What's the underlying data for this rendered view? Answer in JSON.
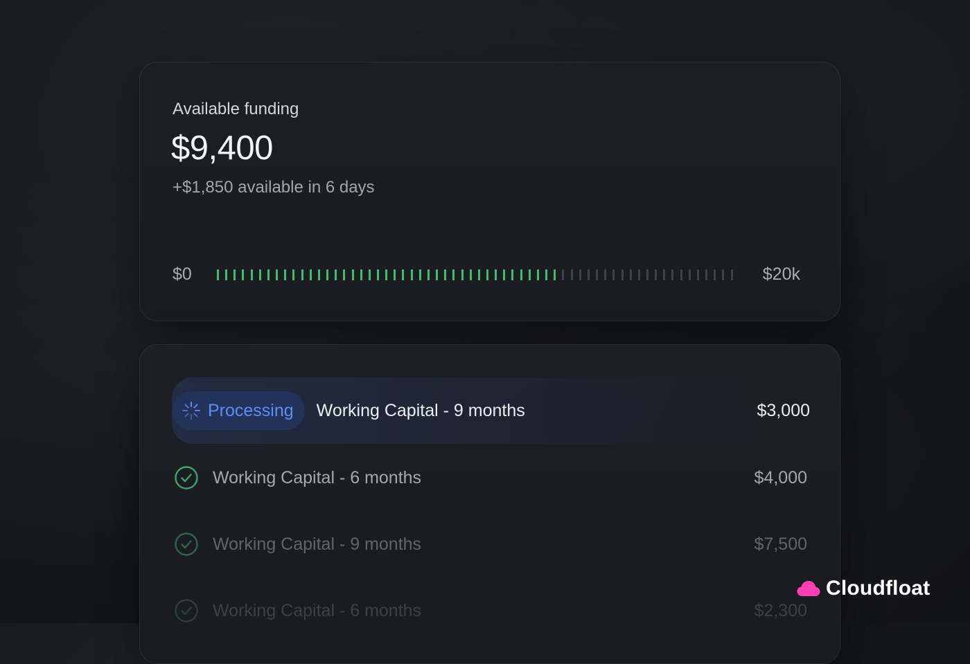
{
  "funding": {
    "label": "Available funding",
    "amount": "$9,400",
    "subtext": "+$1,850 available in 6 days",
    "range_min": "$0",
    "range_max": "$20k",
    "meter_fraction": 0.66,
    "meter_ticks": 62
  },
  "transactions": [
    {
      "status": "Processing",
      "title": "Working Capital - 9 months",
      "amount": "$3,000"
    },
    {
      "status": "complete",
      "title": "Working Capital - 6 months",
      "amount": "$4,000"
    },
    {
      "status": "complete",
      "title": "Working Capital - 9 months",
      "amount": "$7,500"
    },
    {
      "status": "complete",
      "title": "Working Capital - 6 months",
      "amount": "$2,300"
    }
  ],
  "brand": {
    "name": "Cloudfloat",
    "icon": "cloud-icon",
    "accent": "#ff3fb4"
  },
  "colors": {
    "meter_on": "#3fbf6c",
    "meter_off": "#3e4148",
    "processing": "#5d8ef5",
    "check": "#3fa366"
  }
}
